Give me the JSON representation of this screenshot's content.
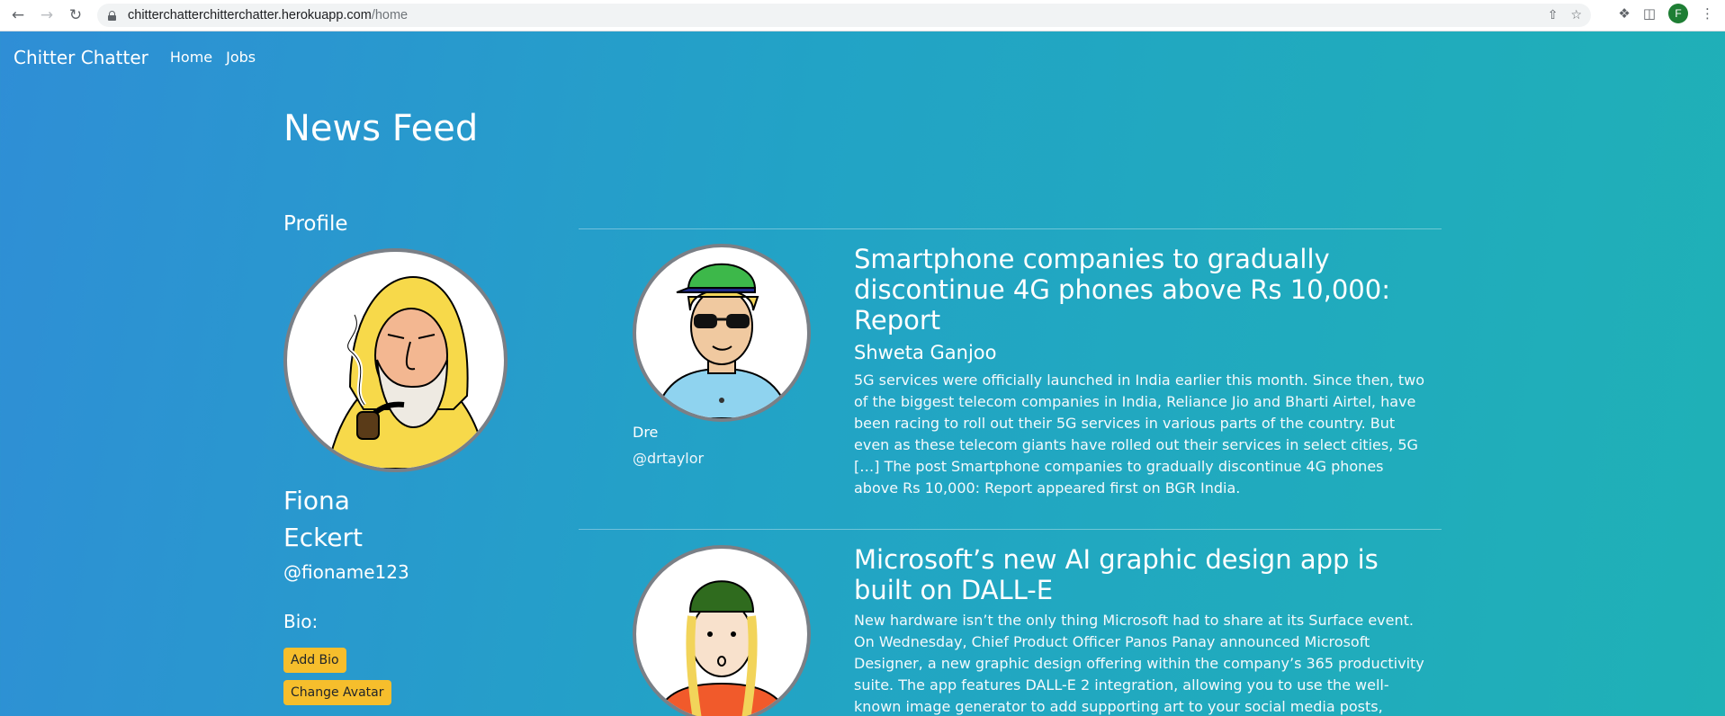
{
  "browser": {
    "url_host": "chitterchatterchitterchatter.herokuapp.com",
    "url_path": "/home",
    "profile_initial": "F"
  },
  "navbar": {
    "brand": "Chitter Chatter",
    "links": [
      "Home",
      "Jobs"
    ]
  },
  "page": {
    "title": "News Feed"
  },
  "profile": {
    "heading": "Profile",
    "first_name": "Fiona",
    "last_name": "Eckert",
    "handle": "@fioname123",
    "bio_label": "Bio:",
    "add_bio": "Add Bio",
    "change_avatar": "Change Avatar"
  },
  "posts": [
    {
      "user": "Dre",
      "handle": "@drtaylor",
      "title": "Smartphone companies to gradually discontinue 4G phones above Rs 10,000: Report",
      "author": "Shweta Ganjoo",
      "body": "5G services were officially launched in India earlier this month. Since then, two of the biggest telecom companies in India, Reliance Jio and Bharti Airtel, have been racing to roll out their 5G services in various parts of the country. But even as these telecom giants have rolled out their services in select cities, 5G […] The post Smartphone companies to gradually discontinue 4G phones above Rs 10,000: Report appeared first on BGR India."
    },
    {
      "title": "Microsoft’s new AI graphic design app is built on DALL-E",
      "body": "New hardware isn’t the only thing Microsoft had to share at its Surface event. On Wednesday, Chief Product Officer Panos Panay announced Microsoft Designer, a new graphic design offering within the company’s 365 productivity suite. The app features DALL-E 2 integration, allowing you to use the well-known image generator to add supporting art to your social media posts,"
    }
  ],
  "colors": {
    "gradient_start": "#2f8ed6",
    "gradient_end": "#1fb1b6",
    "button": "#f6be2c"
  }
}
